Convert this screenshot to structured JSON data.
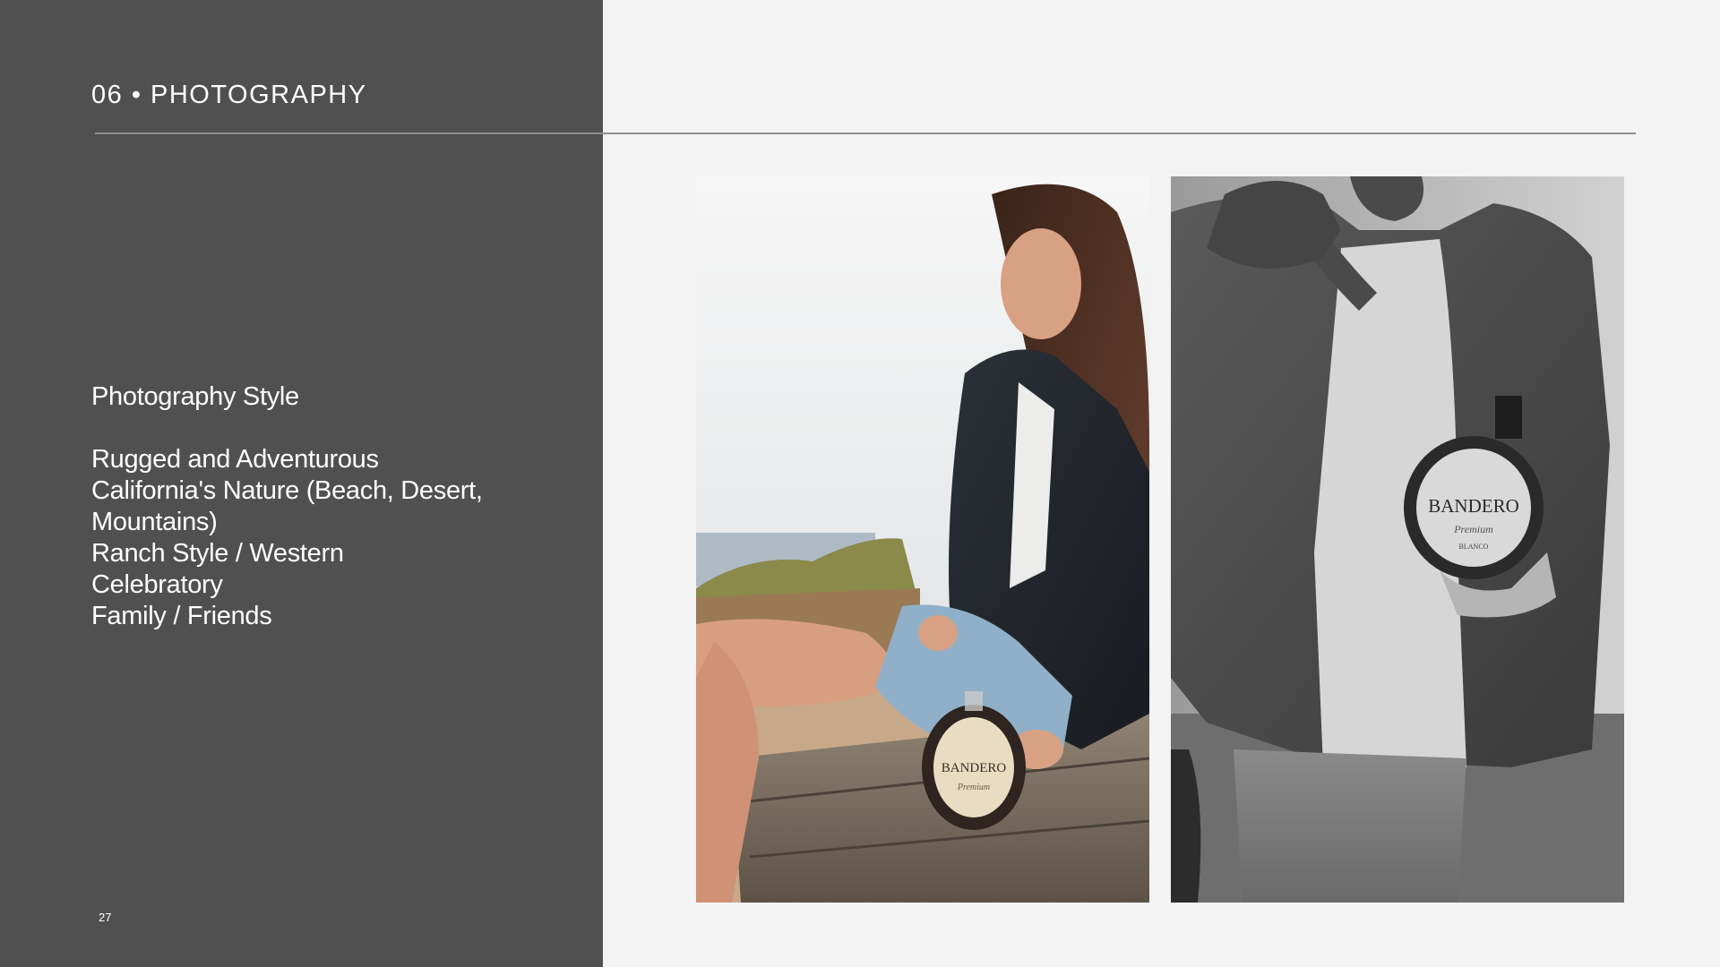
{
  "slide": {
    "section_title": "06 • PHOTOGRAPHY",
    "page_number": "27"
  },
  "content": {
    "heading": "Photography Style",
    "items": [
      "Rugged and Adventurous",
      "California's Nature (Beach, Desert, Mountains)",
      "Ranch Style / Western",
      "Celebratory",
      "Family / Friends"
    ]
  },
  "photos": [
    {
      "name": "woman-with-bottle-photo",
      "color_mode": "color"
    },
    {
      "name": "man-with-bottle-photo",
      "color_mode": "black-and-white"
    }
  ],
  "bottle_labels": {
    "brand": "BANDERO",
    "variant": "Premium",
    "type": "BLANCO"
  }
}
